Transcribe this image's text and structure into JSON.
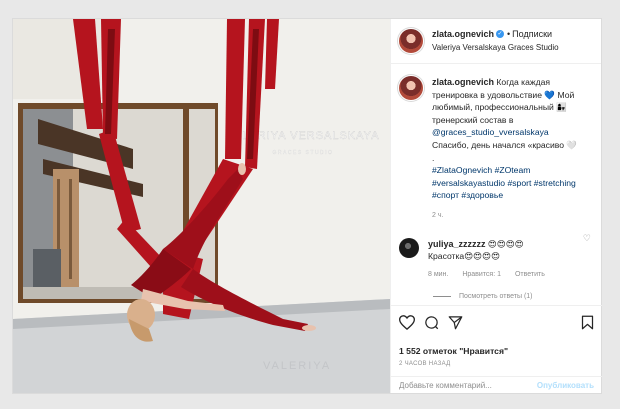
{
  "post": {
    "username": "zlata.ognevich",
    "verified_mark": "✓",
    "separator": "•",
    "follow_label": "Подписки",
    "location": "Valeriya Versalskaya Graces Studio",
    "caption": {
      "username": "zlata.ognevich",
      "text_1": "Когда каждая тренировка в удовольствие 💙 Мой любимый, профессиональный 👩‍👧 тренерский состав в",
      "mention": "@graces_studio_vversalskaya",
      "text_2": "Спасибо, день начался «красиво 🤍",
      "dot": ".",
      "hashtags_1": "#ZlataOgnevich #ZOteam",
      "hashtags_2": "#versalskayastudio #sport #stretching",
      "hashtags_3": "#спорт #здоровье",
      "age": "2 ч."
    },
    "comment": {
      "username": "yuliya_zzzzzz",
      "emoji_1": "😍😍😍😍",
      "text": "Красотка",
      "emoji_2": "😍😍😍😍",
      "age": "8 мин.",
      "likes": "Нравится: 1",
      "reply": "Ответить",
      "heart_icon": "heart-icon"
    },
    "view_replies": "Посмотреть ответы (1)",
    "likes_count": "1 552 отметок \"Нравится\"",
    "posted_ago": "2 ЧАСОВ НАЗАД",
    "add_comment_placeholder": "Добавьте комментарий...",
    "publish_label": "Опубликовать",
    "photo_sign": "VALERIYA VERSALSKAYA",
    "photo_sign_sub": "GRACES STUDIO",
    "photo_floor_text": "VALERIYA"
  },
  "colors": {
    "accent_blue": "#3897f0",
    "link_blue": "#00376b",
    "silk_red": "#b5141e",
    "muted": "#8e8e8e"
  },
  "icons": [
    "heart-icon",
    "comment-icon",
    "share-icon",
    "bookmark-icon",
    "verified-badge-icon"
  ]
}
